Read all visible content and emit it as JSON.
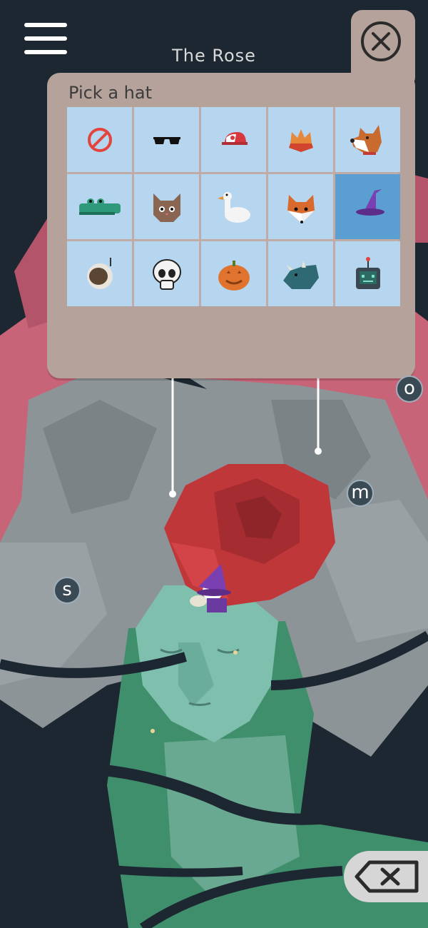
{
  "level": {
    "title": "The Rose"
  },
  "hat_picker": {
    "title": "Pick a hat",
    "selected_index": 9,
    "hats": [
      {
        "icon": "no-hat-icon"
      },
      {
        "icon": "sunglasses-icon"
      },
      {
        "icon": "cap-icon"
      },
      {
        "icon": "crown-icon"
      },
      {
        "icon": "dog-icon"
      },
      {
        "icon": "crocodile-icon"
      },
      {
        "icon": "cat-icon"
      },
      {
        "icon": "goose-icon"
      },
      {
        "icon": "fox-icon"
      },
      {
        "icon": "wizard-hat-icon"
      },
      {
        "icon": "astronaut-helmet-icon"
      },
      {
        "icon": "skull-icon"
      },
      {
        "icon": "pumpkin-icon"
      },
      {
        "icon": "triceratops-icon"
      },
      {
        "icon": "robot-icon"
      }
    ]
  },
  "letters": [
    "o",
    "m",
    "s"
  ],
  "colors": {
    "background": "#1d2731",
    "panel": "#b5a29b",
    "cell": "#b6d6f0",
    "cell_selected": "#5b9fd2",
    "rose": "#c0373a",
    "face": "#7fbfae",
    "pink_backdrop": "#c76478"
  }
}
